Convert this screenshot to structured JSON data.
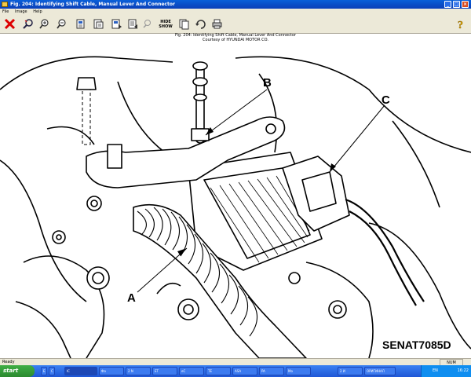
{
  "window": {
    "title": "Fig. 204: Identifying Shift Cable, Manual Lever And Connector"
  },
  "menu": [
    "File",
    "Image",
    "Help"
  ],
  "toolbar": {
    "hide_show_top": "HIDE",
    "hide_show_bottom": "SHOW",
    "icons": [
      "close-icon",
      "search-icon",
      "zoom-in-icon",
      "zoom-out-icon",
      "page-1-icon",
      "page-2-icon",
      "page-3-icon",
      "page-4-icon",
      "print-icon",
      "rotate-icon",
      "printer-icon",
      "help-icon"
    ]
  },
  "figure": {
    "caption_line1": "Fig. 204: Identifying Shift Cable, Manual Lever And Connector",
    "caption_line2": "Courtesy of HYUNDAI MOTOR CO.",
    "callouts": [
      "A",
      "B",
      "C"
    ],
    "code": "SENAT7085D"
  },
  "status": {
    "left": "Ready",
    "right": "NUM"
  },
  "taskbar": {
    "start": "start",
    "tasks": [
      "E",
      "C",
      "IC",
      "Фо",
      "2 N",
      "ET",
      "eC",
      "TE",
      "ASA",
      "PA",
      "Mo",
      "2 И",
      "ОРИГИНАЛ"
    ],
    "lang": "EN",
    "clock": "16:22"
  },
  "colors": {
    "titlebar": "#0b4fd0",
    "close_red": "#d9491d",
    "taskbar": "#2a68e0",
    "start_green": "#3a9e3f"
  }
}
